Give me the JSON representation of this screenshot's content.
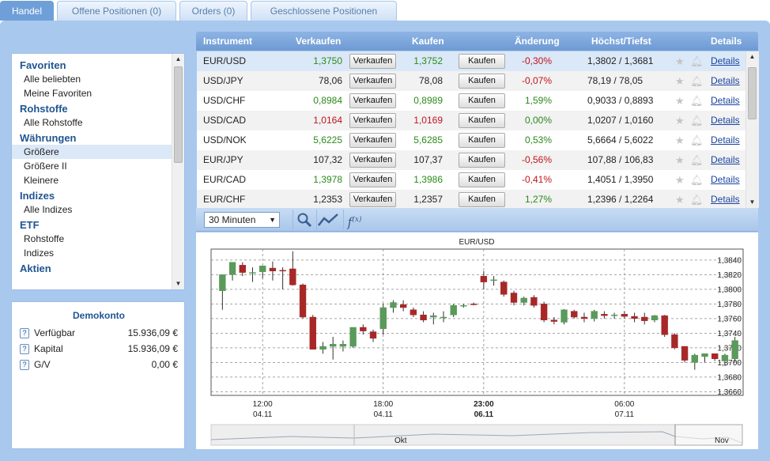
{
  "tabs": [
    {
      "label": "Handel",
      "active": true
    },
    {
      "label": "Offene Positionen (0)",
      "active": false
    },
    {
      "label": "Orders (0)",
      "active": false
    },
    {
      "label": "Geschlossene Positionen",
      "active": false
    }
  ],
  "sidebar": {
    "groups": [
      {
        "title": "Favoriten",
        "items": [
          {
            "label": "Alle beliebten",
            "selected": false
          },
          {
            "label": "Meine Favoriten",
            "selected": false
          }
        ]
      },
      {
        "title": "Rohstoffe",
        "items": [
          {
            "label": "Alle Rohstoffe",
            "selected": false
          }
        ]
      },
      {
        "title": "Währungen",
        "items": [
          {
            "label": "Größere",
            "selected": true
          },
          {
            "label": "Größere II",
            "selected": false
          },
          {
            "label": "Kleinere",
            "selected": false
          }
        ]
      },
      {
        "title": "Indizes",
        "items": [
          {
            "label": "Alle Indizes",
            "selected": false
          }
        ]
      },
      {
        "title": "ETF",
        "items": [
          {
            "label": "Rohstoffe",
            "selected": false
          },
          {
            "label": "Indizes",
            "selected": false
          }
        ]
      },
      {
        "title": "Aktien",
        "items": []
      }
    ]
  },
  "account": {
    "title": "Demokonto",
    "help_glyph": "?",
    "rows": [
      {
        "label": "Verfügbar",
        "value": "15.936,09 €"
      },
      {
        "label": "Kapital",
        "value": "15.936,09 €"
      },
      {
        "label": "G/V",
        "value": "0,00 €"
      }
    ]
  },
  "table": {
    "headers": {
      "instrument": "Instrument",
      "sell": "Verkaufen",
      "buy": "Kaufen",
      "change": "Änderung",
      "highlow": "Höchst/Tiefst",
      "details": "Details"
    },
    "sell_button": "Verkaufen",
    "buy_button": "Kaufen",
    "details_link": "Details",
    "rows": [
      {
        "instrument": "EUR/USD",
        "sell": "1,3750",
        "sell_dir": "up",
        "buy": "1,3752",
        "buy_dir": "up",
        "change": "-0,30%",
        "change_dir": "down",
        "highlow": "1,3802 / 1,3681",
        "selected": true
      },
      {
        "instrument": "USD/JPY",
        "sell": "78,06",
        "sell_dir": "flat",
        "buy": "78,08",
        "buy_dir": "flat",
        "change": "-0,07%",
        "change_dir": "down",
        "highlow": "78,19 / 78,05",
        "selected": false
      },
      {
        "instrument": "USD/CHF",
        "sell": "0,8984",
        "sell_dir": "up",
        "buy": "0,8989",
        "buy_dir": "up",
        "change": "1,59%",
        "change_dir": "up",
        "highlow": "0,9033 / 0,8893",
        "selected": false
      },
      {
        "instrument": "USD/CAD",
        "sell": "1,0164",
        "sell_dir": "down",
        "buy": "1,0169",
        "buy_dir": "down",
        "change": "0,00%",
        "change_dir": "up",
        "highlow": "1,0207 / 1,0160",
        "selected": false
      },
      {
        "instrument": "USD/NOK",
        "sell": "5,6225",
        "sell_dir": "up",
        "buy": "5,6285",
        "buy_dir": "up",
        "change": "0,53%",
        "change_dir": "up",
        "highlow": "5,6664 / 5,6022",
        "selected": false
      },
      {
        "instrument": "EUR/JPY",
        "sell": "107,32",
        "sell_dir": "flat",
        "buy": "107,37",
        "buy_dir": "flat",
        "change": "-0,56%",
        "change_dir": "down",
        "highlow": "107,88 / 106,83",
        "selected": false
      },
      {
        "instrument": "EUR/CAD",
        "sell": "1,3978",
        "sell_dir": "up",
        "buy": "1,3986",
        "buy_dir": "up",
        "change": "-0,41%",
        "change_dir": "down",
        "highlow": "1,4051 / 1,3950",
        "selected": false
      },
      {
        "instrument": "EUR/CHF",
        "sell": "1,2353",
        "sell_dir": "flat",
        "buy": "1,2357",
        "buy_dir": "flat",
        "change": "1,27%",
        "change_dir": "up",
        "highlow": "1,2396 / 1,2264",
        "selected": false
      }
    ]
  },
  "chart_toolbar": {
    "interval": "30 Minuten"
  },
  "colors": {
    "up": "#2a8a1a",
    "down": "#c0141c",
    "bull_candle": "#5a9a5a",
    "bear_candle": "#a82828",
    "accent": "#6f9fd8"
  },
  "chart_data": {
    "type": "candlestick",
    "title": "EUR/USD",
    "ylim": [
      1.3655,
      1.3855
    ],
    "y_ticks": [
      "1,3840",
      "1,3820",
      "1,3800",
      "1,3780",
      "1,3760",
      "1,3740",
      "1,3720",
      "1,3700",
      "1,3680",
      "1,3660"
    ],
    "y_tick_values": [
      1.384,
      1.382,
      1.38,
      1.378,
      1.376,
      1.374,
      1.372,
      1.37,
      1.368,
      1.366
    ],
    "x_ticks": [
      {
        "time": "12:00",
        "date": "04.11",
        "index": 4,
        "bold": false
      },
      {
        "time": "18:00",
        "date": "04.11",
        "index": 16,
        "bold": false
      },
      {
        "time": "23:00",
        "date": "06.11",
        "index": 26,
        "bold": true
      },
      {
        "time": "06:00",
        "date": "07.11",
        "index": 40,
        "bold": false
      }
    ],
    "navigator_labels": [
      "Okt",
      "Nov"
    ],
    "candles": [
      {
        "o": 1.3798,
        "h": 1.3818,
        "l": 1.3772,
        "c": 1.382
      },
      {
        "o": 1.382,
        "h": 1.3832,
        "l": 1.3812,
        "c": 1.3837
      },
      {
        "o": 1.3833,
        "h": 1.3837,
        "l": 1.3818,
        "c": 1.3823
      },
      {
        "o": 1.3823,
        "h": 1.383,
        "l": 1.381,
        "c": 1.3823
      },
      {
        "o": 1.3824,
        "h": 1.383,
        "l": 1.3815,
        "c": 1.3832
      },
      {
        "o": 1.3829,
        "h": 1.3838,
        "l": 1.3812,
        "c": 1.3825
      },
      {
        "o": 1.3826,
        "h": 1.383,
        "l": 1.38,
        "c": 1.3825
      },
      {
        "o": 1.3828,
        "h": 1.3852,
        "l": 1.3805,
        "c": 1.3806
      },
      {
        "o": 1.3806,
        "h": 1.3808,
        "l": 1.376,
        "c": 1.3762
      },
      {
        "o": 1.3762,
        "h": 1.3765,
        "l": 1.3722,
        "c": 1.3718
      },
      {
        "o": 1.3718,
        "h": 1.3728,
        "l": 1.3712,
        "c": 1.3722
      },
      {
        "o": 1.3722,
        "h": 1.3735,
        "l": 1.3704,
        "c": 1.3725
      },
      {
        "o": 1.3722,
        "h": 1.373,
        "l": 1.3715,
        "c": 1.3725
      },
      {
        "o": 1.3722,
        "h": 1.3748,
        "l": 1.372,
        "c": 1.3748
      },
      {
        "o": 1.3748,
        "h": 1.3752,
        "l": 1.3738,
        "c": 1.3743
      },
      {
        "o": 1.3742,
        "h": 1.3745,
        "l": 1.3728,
        "c": 1.3733
      },
      {
        "o": 1.3746,
        "h": 1.378,
        "l": 1.3738,
        "c": 1.3775
      },
      {
        "o": 1.3775,
        "h": 1.3785,
        "l": 1.3768,
        "c": 1.3782
      },
      {
        "o": 1.3779,
        "h": 1.3785,
        "l": 1.377,
        "c": 1.3775
      },
      {
        "o": 1.3772,
        "h": 1.3775,
        "l": 1.3762,
        "c": 1.3765
      },
      {
        "o": 1.3765,
        "h": 1.377,
        "l": 1.3755,
        "c": 1.3758
      },
      {
        "o": 1.3762,
        "h": 1.3768,
        "l": 1.3752,
        "c": 1.3764
      },
      {
        "o": 1.3762,
        "h": 1.377,
        "l": 1.3755,
        "c": 1.3762
      },
      {
        "o": 1.3765,
        "h": 1.378,
        "l": 1.3762,
        "c": 1.3778
      },
      {
        "o": 1.3778,
        "h": 1.378,
        "l": 1.3775,
        "c": 1.3778
      },
      {
        "o": 1.378,
        "h": 1.3782,
        "l": 1.3778,
        "c": 1.3779
      },
      {
        "o": 1.3818,
        "h": 1.3825,
        "l": 1.38,
        "c": 1.381
      },
      {
        "o": 1.3812,
        "h": 1.3818,
        "l": 1.3805,
        "c": 1.3813
      },
      {
        "o": 1.381,
        "h": 1.3812,
        "l": 1.379,
        "c": 1.3793
      },
      {
        "o": 1.3795,
        "h": 1.3798,
        "l": 1.3778,
        "c": 1.3782
      },
      {
        "o": 1.3782,
        "h": 1.379,
        "l": 1.3778,
        "c": 1.3788
      },
      {
        "o": 1.3789,
        "h": 1.3792,
        "l": 1.3775,
        "c": 1.3778
      },
      {
        "o": 1.378,
        "h": 1.3783,
        "l": 1.3755,
        "c": 1.3758
      },
      {
        "o": 1.3758,
        "h": 1.3762,
        "l": 1.3752,
        "c": 1.3756
      },
      {
        "o": 1.3755,
        "h": 1.3773,
        "l": 1.3752,
        "c": 1.3772
      },
      {
        "o": 1.377,
        "h": 1.3772,
        "l": 1.376,
        "c": 1.3762
      },
      {
        "o": 1.3762,
        "h": 1.3768,
        "l": 1.3755,
        "c": 1.376
      },
      {
        "o": 1.376,
        "h": 1.3772,
        "l": 1.3756,
        "c": 1.377
      },
      {
        "o": 1.3766,
        "h": 1.377,
        "l": 1.376,
        "c": 1.3764
      },
      {
        "o": 1.3764,
        "h": 1.3768,
        "l": 1.376,
        "c": 1.3765
      },
      {
        "o": 1.3766,
        "h": 1.377,
        "l": 1.376,
        "c": 1.3763
      },
      {
        "o": 1.3763,
        "h": 1.3768,
        "l": 1.3755,
        "c": 1.376
      },
      {
        "o": 1.3762,
        "h": 1.3768,
        "l": 1.3752,
        "c": 1.3757
      },
      {
        "o": 1.3758,
        "h": 1.3765,
        "l": 1.3755,
        "c": 1.3764
      },
      {
        "o": 1.3764,
        "h": 1.3765,
        "l": 1.3735,
        "c": 1.3738
      },
      {
        "o": 1.3738,
        "h": 1.374,
        "l": 1.3718,
        "c": 1.372
      },
      {
        "o": 1.3722,
        "h": 1.3722,
        "l": 1.37,
        "c": 1.3703
      },
      {
        "o": 1.37,
        "h": 1.3712,
        "l": 1.369,
        "c": 1.371
      },
      {
        "o": 1.3708,
        "h": 1.3712,
        "l": 1.37,
        "c": 1.3712
      },
      {
        "o": 1.3712,
        "h": 1.3712,
        "l": 1.3702,
        "c": 1.3705
      },
      {
        "o": 1.3702,
        "h": 1.3712,
        "l": 1.3695,
        "c": 1.371
      },
      {
        "o": 1.3705,
        "h": 1.3735,
        "l": 1.37,
        "c": 1.373
      }
    ]
  }
}
